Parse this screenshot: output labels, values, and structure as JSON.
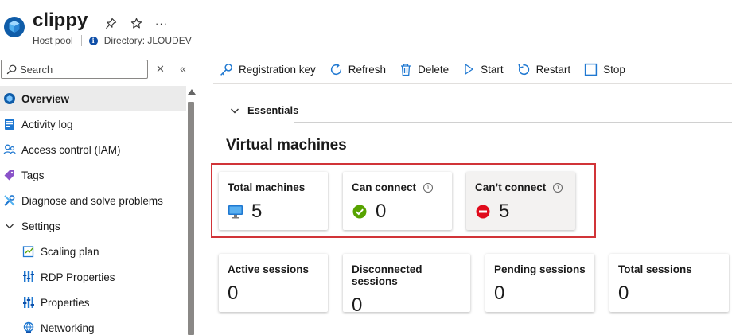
{
  "header": {
    "title": "clippy",
    "subtitle": "Host pool",
    "directory": "Directory: JLOUDEV",
    "actions": [
      "pin-icon",
      "star-icon",
      "more-icon"
    ]
  },
  "sidebar": {
    "search_placeholder": "Search",
    "items": [
      {
        "label": "Overview",
        "icon": "overview-icon",
        "active": true
      },
      {
        "label": "Activity log",
        "icon": "activity-log-icon"
      },
      {
        "label": "Access control (IAM)",
        "icon": "iam-icon"
      },
      {
        "label": "Tags",
        "icon": "tag-icon"
      },
      {
        "label": "Diagnose and solve problems",
        "icon": "wrench-icon"
      },
      {
        "label": "Settings",
        "icon": "chevron-down-icon"
      },
      {
        "label": "Scaling plan",
        "icon": "scaling-plan-icon"
      },
      {
        "label": "RDP Properties",
        "icon": "rdp-properties-icon"
      },
      {
        "label": "Properties",
        "icon": "properties-icon"
      },
      {
        "label": "Networking",
        "icon": "networking-icon"
      }
    ]
  },
  "toolbar": {
    "registration_key": "Registration key",
    "refresh": "Refresh",
    "delete": "Delete",
    "start": "Start",
    "restart": "Restart",
    "stop": "Stop"
  },
  "essentials_label": "Essentials",
  "virtual_machines": {
    "title": "Virtual machines",
    "total": {
      "label": "Total machines",
      "value": "5"
    },
    "can_connect": {
      "label": "Can connect",
      "value": "0"
    },
    "cant_connect": {
      "label": "Can’t connect",
      "value": "5"
    }
  },
  "sessions": {
    "active": {
      "label": "Active sessions",
      "value": "0"
    },
    "disconnected": {
      "label": "Disconnected sessions",
      "value": "0"
    },
    "pending": {
      "label": "Pending sessions",
      "value": "0"
    },
    "total": {
      "label": "Total sessions",
      "value": "0"
    }
  },
  "colors": {
    "accent": "#0078d4",
    "highlight_border": "#d13438",
    "success": "#57a300",
    "error": "#e00b1c"
  }
}
